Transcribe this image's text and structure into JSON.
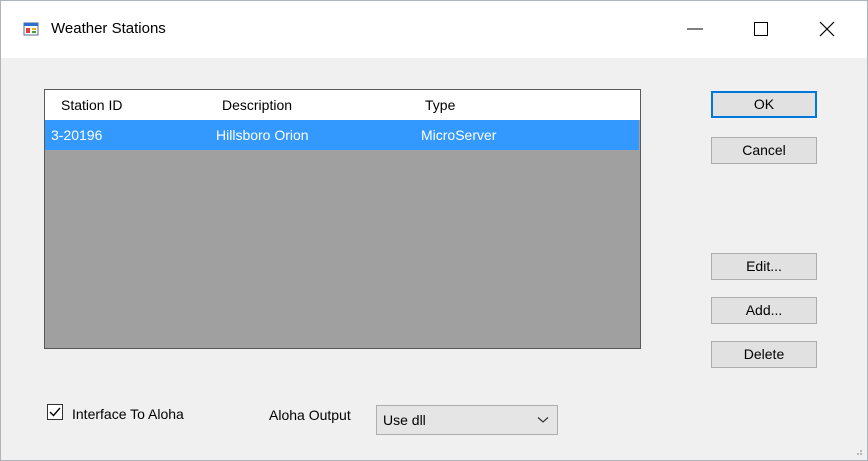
{
  "window": {
    "title": "Weather Stations",
    "app_icon": "form-app-icon",
    "controls": [
      "minimize-icon",
      "maximize-icon",
      "close-icon"
    ]
  },
  "stations_list": {
    "columns": [
      "Station ID",
      "Description",
      "Type"
    ],
    "rows": [
      {
        "station_id": "3-20196",
        "description": "Hillsboro Orion",
        "type": "MicroServer",
        "selected": true
      }
    ]
  },
  "buttons": {
    "ok": "OK",
    "cancel": "Cancel",
    "edit": "Edit...",
    "add": "Add...",
    "delete": "Delete"
  },
  "interface_to_aloha": {
    "label": "Interface To Aloha",
    "checked": true
  },
  "aloha_output": {
    "label": "Aloha Output",
    "value": "Use dll"
  },
  "colors": {
    "selection": "#3399ff",
    "list_background": "#a0a0a0",
    "default_button_border": "#0078d7",
    "window_background": "#f0f0f0"
  }
}
